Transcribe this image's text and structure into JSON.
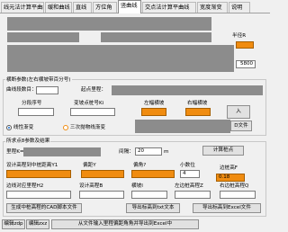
{
  "tabs": [
    "线元法计算平曲线",
    "缓和曲线",
    "直线",
    "方位角",
    "竖曲线",
    "交点法计算平曲线",
    "宽度渐变",
    "说明"
  ],
  "top": {
    "side_label": "半径R",
    "value_5800": "5800"
  },
  "coord": {
    "group_title": "横断参数(左右横坡带百分号)",
    "curve_segment_label": "曲线段数目：",
    "start_chainage_label": "起点里程：",
    "headers": [
      "分段序号",
      "变坡点桩号Ki",
      "左幅横坡",
      "右幅横坡"
    ],
    "enter_button": "入",
    "radio_linear": "线性渐变",
    "radio_cubic": "三次抛物线渐变",
    "file_button": "D文件"
  },
  "calc": {
    "group_title": "所求点8参数及结果",
    "chainage_label": "里程K=",
    "interval_label": "间隔：",
    "interval_value": "20",
    "unit_m": "m",
    "calc_point_button": "计算桩点",
    "row1_labels": [
      "设计高程到中桩距离Y1",
      "偏距Y",
      "偏角?",
      "小数位"
    ],
    "row1_values": [
      "",
      "",
      "",
      ""
    ],
    "decimal_value": "4",
    "side_elev_left_label": "边桩高F",
    "side_elev_value": "0.18",
    "row2_labels": [
      "边线对应里程H2",
      "设计高程B",
      "横坡I",
      "左边桩高程Z",
      "右边桩高程Q"
    ],
    "bottom_buttons": {
      "gen_cad": "生成中桩高程的CAD脚本文件",
      "export_txt": "导出标高到txt文本",
      "export_excel": "导出标高到Excel文件"
    }
  },
  "footer": {
    "edit_zdp": "编辑zdp",
    "edit_zxz": "编辑zxz",
    "note": "从文件输入里程偏距角角并导出到Excel中"
  },
  "colors": {
    "accent": "#f08c10",
    "mask": "#8c8c8c"
  }
}
